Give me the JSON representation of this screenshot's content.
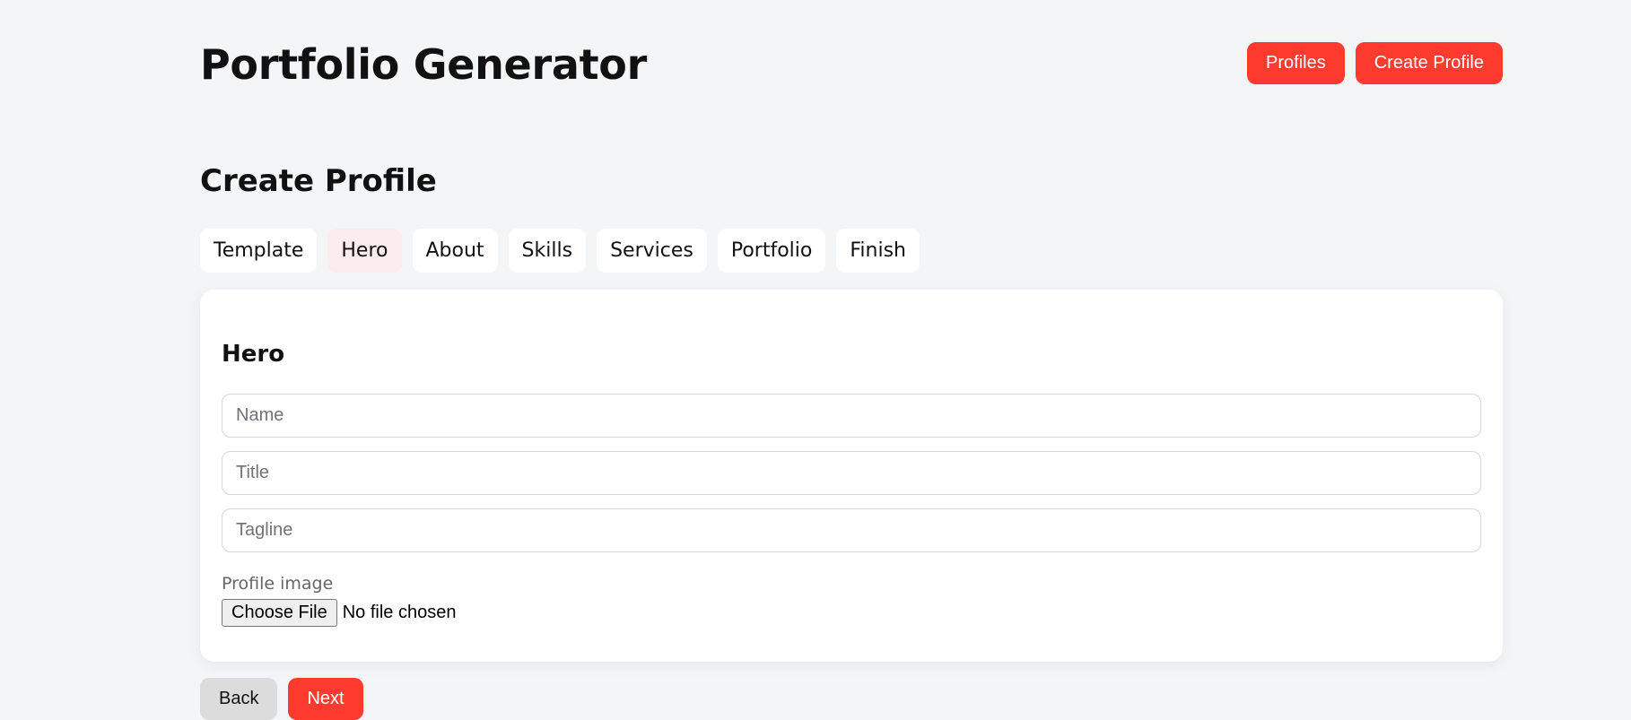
{
  "header": {
    "title": "Portfolio Generator",
    "nav": {
      "profiles_label": "Profiles",
      "create_profile_label": "Create Profile"
    }
  },
  "page": {
    "title": "Create Profile"
  },
  "tabs": [
    {
      "label": "Template",
      "active": false
    },
    {
      "label": "Hero",
      "active": true
    },
    {
      "label": "About",
      "active": false
    },
    {
      "label": "Skills",
      "active": false
    },
    {
      "label": "Services",
      "active": false
    },
    {
      "label": "Portfolio",
      "active": false
    },
    {
      "label": "Finish",
      "active": false
    }
  ],
  "hero_form": {
    "title": "Hero",
    "name": {
      "value": "",
      "placeholder": "Name"
    },
    "job_title": {
      "value": "",
      "placeholder": "Title"
    },
    "tagline": {
      "value": "",
      "placeholder": "Tagline"
    },
    "profile_image": {
      "label": "Profile image",
      "button_label": "Choose File",
      "status": "No file chosen"
    }
  },
  "actions": {
    "back_label": "Back",
    "next_label": "Next"
  },
  "colors": {
    "accent": "#ff3b30",
    "active_tab_bg": "#fdecec",
    "page_bg": "#f4f5f7",
    "back_button_bg": "#dcdcdc"
  }
}
